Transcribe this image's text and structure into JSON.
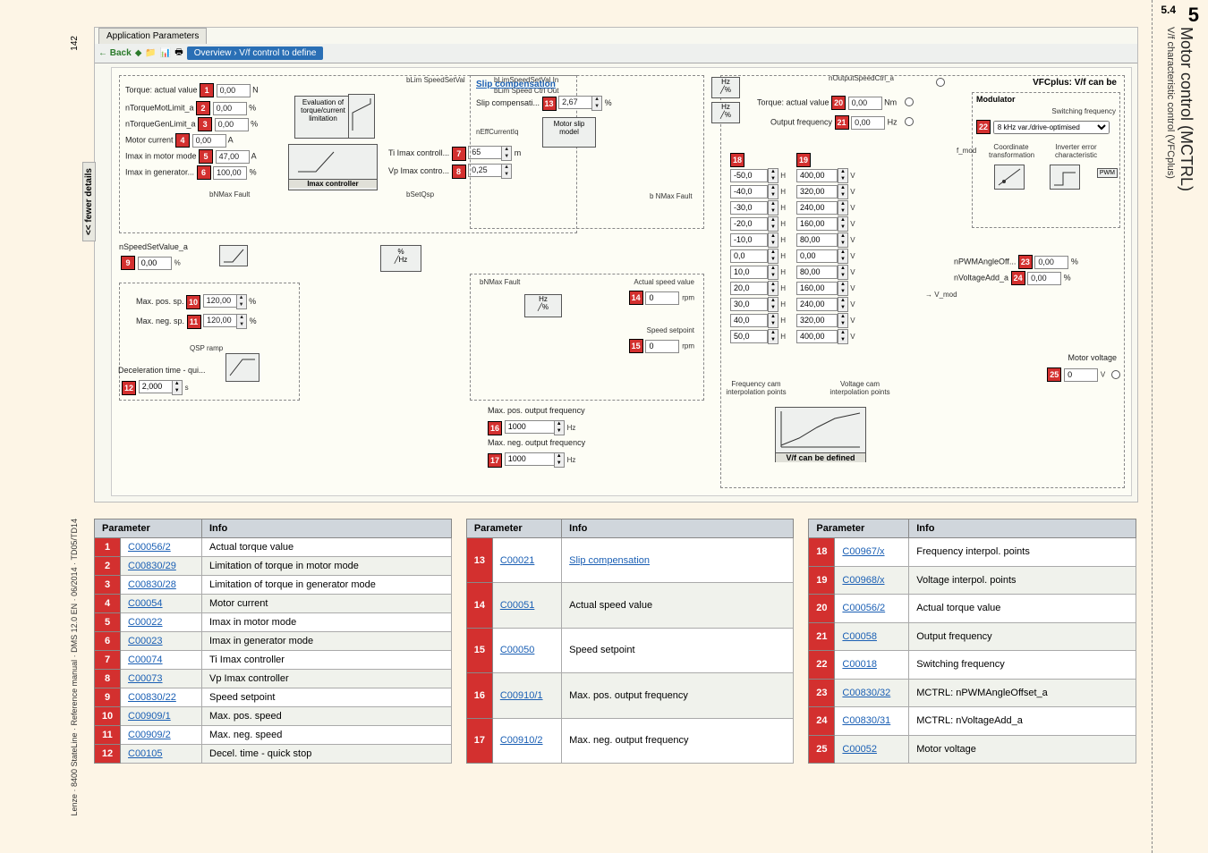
{
  "page": {
    "chapter_num": "5",
    "subchapter_num": "5.4",
    "title": "Motor control (MCTRL)",
    "subtitle": "V/f characteristic control (VFCplus)",
    "page_number": "142",
    "footer": "Lenze · 8400 StateLine · Reference manual · DMS 12.0 EN · 06/2014 · TD05/TD14"
  },
  "app": {
    "tab_title": "Application Parameters",
    "nav_back": "← Back",
    "breadcrumb": "Overview › V/f control to define",
    "fewer_details": "<< fewer details"
  },
  "diagram": {
    "left_block": {
      "torque_actual": {
        "label": "Torque: actual value",
        "badge": "1",
        "value": "0,00",
        "unit": "N"
      },
      "nTorqueMotLimit": {
        "label": "nTorqueMotLimit_a",
        "badge": "2",
        "value": "0,00",
        "unit": "%"
      },
      "nTorqueGenLimit": {
        "label": "nTorqueGenLimit_a",
        "badge": "3",
        "value": "0,00",
        "unit": "%"
      },
      "motor_current": {
        "label": "Motor current",
        "badge": "4",
        "value": "0,00",
        "unit": "A"
      },
      "imax_motor_mode": {
        "label": "Imax in motor mode",
        "badge": "5",
        "value": "47,00",
        "unit": "A"
      },
      "imax_gen": {
        "label": "Imax in generator...",
        "badge": "6",
        "value": "100,00",
        "unit": "%"
      },
      "eval_caption": "Evaluation of torque/current limitation",
      "imax_controller": "Imax controller",
      "ti_imax": {
        "label": "Ti Imax controll...",
        "badge": "7",
        "value": "65",
        "unit": "m"
      },
      "vp_imax": {
        "label": "Vp Imax contro...",
        "badge": "8",
        "value": "0,25"
      },
      "bLimSpeedSetVal": "bLim SpeedSetVal",
      "bLimSpeedSetValIn": "bLimSpeedSetVal In",
      "bLimSpeedCtrlOut": "bLim Speed Ctrl Out",
      "nSpeedSetValue": {
        "label": "nSpeedSetValue_a",
        "badge": "9",
        "value": "0,00",
        "unit": "%"
      },
      "bNMaxFault": "bNMax Fault",
      "bSetQsp": "bSetQsp",
      "max_pos_sp": {
        "label": "Max. pos. sp.",
        "badge": "10",
        "value": "120,00",
        "unit": "%"
      },
      "max_neg_sp": {
        "label": "Max. neg. sp.",
        "badge": "11",
        "value": "120,00",
        "unit": "%"
      },
      "qsp_ramp": "QSP ramp",
      "decel_time": {
        "label": "Deceleration time - qui...",
        "badge": "12",
        "value": "2,000",
        "unit": "s"
      }
    },
    "center_block": {
      "slip_comp_title": "Slip compensation",
      "slip_comp": {
        "label": "Slip compensati...",
        "badge": "13",
        "value": "2,67",
        "unit": "%"
      },
      "nEffCurrentIq": "nEffCurrentIq",
      "motor_slip_model": "Motor slip model",
      "actual_speed": {
        "label": "Actual speed value",
        "badge": "14",
        "value": "0",
        "unit": "rpm"
      },
      "speed_setpoint": {
        "label": "Speed setpoint",
        "badge": "15",
        "value": "0",
        "unit": "rpm"
      },
      "max_pos_out_freq": {
        "label": "Max. pos. output frequency",
        "badge": "16",
        "value": "1000",
        "unit": "Hz"
      },
      "max_neg_out_freq": {
        "label": "Max. neg. output frequency",
        "badge": "17",
        "value": "1000",
        "unit": "Hz"
      },
      "bNMaxFault2": "b NMax Fault"
    },
    "right_block": {
      "nOutputSpeedCtrl": "nOutputSpeedCtrl_a",
      "torque_actual2": {
        "label": "Torque: actual value",
        "badge": "20",
        "value": "0,00",
        "unit": "Nm"
      },
      "output_freq": {
        "label": "Output frequency",
        "badge": "21",
        "value": "0,00",
        "unit": "Hz"
      },
      "vfc_title": "VFCplus: V/f can be",
      "modulator": "Modulator",
      "switching_freq_label": "Switching frequency",
      "switching_freq": {
        "badge": "22",
        "value": "8 kHz var./drive-optimised"
      },
      "coord_trans": "Coordinate transformation",
      "inv_err": "Inverter error characteristic",
      "pwm": "PWM",
      "fmod": "f_mod",
      "vmod": "V_mod",
      "nPWMAngleOff": {
        "label": "nPWMAngleOff...",
        "badge": "23",
        "value": "0,00",
        "unit": "%"
      },
      "nVoltageAdd": {
        "label": "nVoltageAdd_a",
        "badge": "24",
        "value": "0,00",
        "unit": "%"
      },
      "motor_voltage": {
        "label": "Motor voltage",
        "badge": "25",
        "value": "0",
        "unit": "V"
      },
      "vf_can_be_defined": "V/f can be defined",
      "freq_interp": "Frequency cam interpolation points",
      "volt_interp": "Voltage cam interpolation points",
      "freq_badge": "18",
      "volt_badge": "19",
      "freq_points": [
        "-50,0",
        "-40,0",
        "-30,0",
        "-20,0",
        "-10,0",
        "0,0",
        "10,0",
        "20,0",
        "30,0",
        "40,0",
        "50,0"
      ],
      "volt_points": [
        "400,00",
        "320,00",
        "240,00",
        "160,00",
        "80,00",
        "0,00",
        "80,00",
        "160,00",
        "240,00",
        "320,00",
        "400,00"
      ],
      "freq_unit": "H",
      "volt_unit": "V"
    }
  },
  "tables": {
    "header_param": "Parameter",
    "header_info": "Info",
    "t1": [
      {
        "n": "1",
        "code": "C00056/2",
        "info": "Actual torque value"
      },
      {
        "n": "2",
        "code": "C00830/29",
        "info": "Limitation of torque in motor mode"
      },
      {
        "n": "3",
        "code": "C00830/28",
        "info": "Limitation of torque in generator mode"
      },
      {
        "n": "4",
        "code": "C00054",
        "info": "Motor current"
      },
      {
        "n": "5",
        "code": "C00022",
        "info": "Imax in motor mode"
      },
      {
        "n": "6",
        "code": "C00023",
        "info": "Imax in generator mode"
      },
      {
        "n": "7",
        "code": "C00074",
        "info": "Ti Imax controller"
      },
      {
        "n": "8",
        "code": "C00073",
        "info": "Vp Imax controller"
      },
      {
        "n": "9",
        "code": "C00830/22",
        "info": "Speed setpoint"
      },
      {
        "n": "10",
        "code": "C00909/1",
        "info": "Max. pos. speed"
      },
      {
        "n": "11",
        "code": "C00909/2",
        "info": "Max. neg. speed"
      },
      {
        "n": "12",
        "code": "C00105",
        "info": "Decel. time - quick stop"
      }
    ],
    "t2": [
      {
        "n": "13",
        "code": "C00021",
        "info": "Slip compensation",
        "link": true
      },
      {
        "n": "14",
        "code": "C00051",
        "info": "Actual speed value"
      },
      {
        "n": "15",
        "code": "C00050",
        "info": "Speed setpoint"
      },
      {
        "n": "16",
        "code": "C00910/1",
        "info": "Max. pos. output frequency"
      },
      {
        "n": "17",
        "code": "C00910/2",
        "info": "Max. neg. output frequency"
      }
    ],
    "t3": [
      {
        "n": "18",
        "code": "C00967/x",
        "info": "Frequency interpol. points"
      },
      {
        "n": "19",
        "code": "C00968/x",
        "info": "Voltage interpol. points"
      },
      {
        "n": "20",
        "code": "C00056/2",
        "info": "Actual torque value"
      },
      {
        "n": "21",
        "code": "C00058",
        "info": "Output frequency"
      },
      {
        "n": "22",
        "code": "C00018",
        "info": "Switching frequency"
      },
      {
        "n": "23",
        "code": "C00830/32",
        "info": "MCTRL: nPWMAngleOffset_a"
      },
      {
        "n": "24",
        "code": "C00830/31",
        "info": "MCTRL: nVoltageAdd_a"
      },
      {
        "n": "25",
        "code": "C00052",
        "info": "Motor voltage"
      }
    ]
  }
}
